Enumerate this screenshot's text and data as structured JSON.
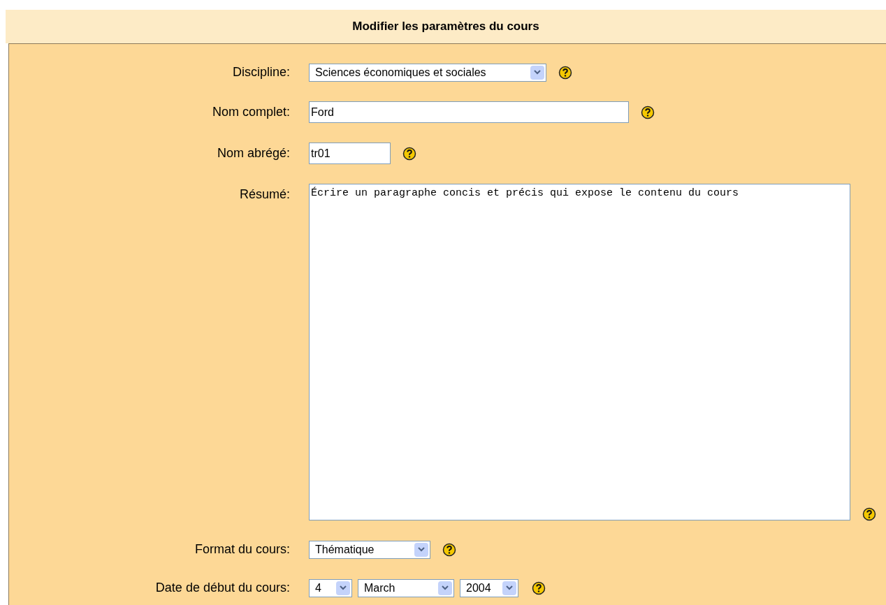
{
  "title": "Modifier les paramètres du cours",
  "fields": [
    {
      "kind": "select",
      "label": "Discipline:",
      "value": "Sciences économiques et sociales"
    },
    {
      "kind": "text",
      "label": "Nom complet:",
      "value": "Ford"
    },
    {
      "kind": "short",
      "label": "Nom abrégé:",
      "value": "tr01"
    },
    {
      "kind": "textarea",
      "label": "Résumé:",
      "value": "Écrire un paragraphe concis et précis qui expose le contenu du cours"
    },
    {
      "kind": "select",
      "label": "Format du cours:",
      "value": "Thématique"
    },
    {
      "kind": "date",
      "label": "Date de début du cours:",
      "parts": [
        "4",
        "March",
        "2004"
      ]
    }
  ]
}
